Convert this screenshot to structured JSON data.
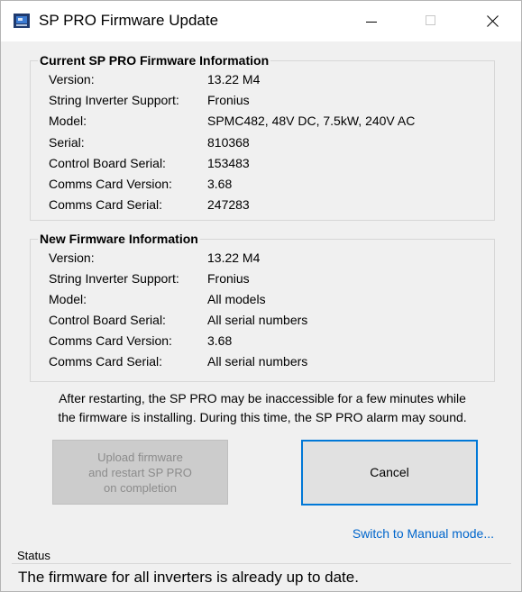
{
  "window": {
    "title": "SP PRO Firmware Update",
    "icon": "sp-pro-app-icon"
  },
  "current_info": {
    "title": "Current SP PRO Firmware Information",
    "rows": [
      {
        "label": "Version:",
        "value": "13.22 M4"
      },
      {
        "label": "String Inverter Support:",
        "value": "Fronius"
      },
      {
        "label": "Model:",
        "value": "SPMC482, 48V DC, 7.5kW, 240V AC"
      },
      {
        "label": "Serial:",
        "value": "810368"
      },
      {
        "label": "Control Board Serial:",
        "value": "153483"
      },
      {
        "label": "Comms Card Version:",
        "value": "3.68"
      },
      {
        "label": "Comms Card Serial:",
        "value": "247283"
      }
    ]
  },
  "new_info": {
    "title": "New Firmware Information",
    "rows": [
      {
        "label": "Version:",
        "value": "13.22 M4"
      },
      {
        "label": "String Inverter Support:",
        "value": "Fronius"
      },
      {
        "label": "Model:",
        "value": "All models"
      },
      {
        "label": "Control Board Serial:",
        "value": "All serial numbers"
      },
      {
        "label": "Comms Card Version:",
        "value": "3.68"
      },
      {
        "label": "Comms Card Serial:",
        "value": "All serial numbers"
      }
    ]
  },
  "warning": {
    "line1": "After restarting, the SP PRO may be inaccessible for a few minutes while",
    "line2": "the firmware is installing. During this time, the SP PRO alarm may sound."
  },
  "buttons": {
    "upload_line1": "Upload firmware",
    "upload_line2": "and restart SP PRO",
    "upload_line3": "on completion",
    "upload_enabled": false,
    "cancel": "Cancel"
  },
  "manual_link": "Switch to Manual mode...",
  "status": {
    "label": "Status",
    "message": "The firmware for all inverters is already up to date."
  },
  "colors": {
    "window_bg": "#f0f0f0",
    "focus_border": "#0078d7",
    "link": "#0066cc",
    "disabled_text": "#8c8c8c"
  }
}
